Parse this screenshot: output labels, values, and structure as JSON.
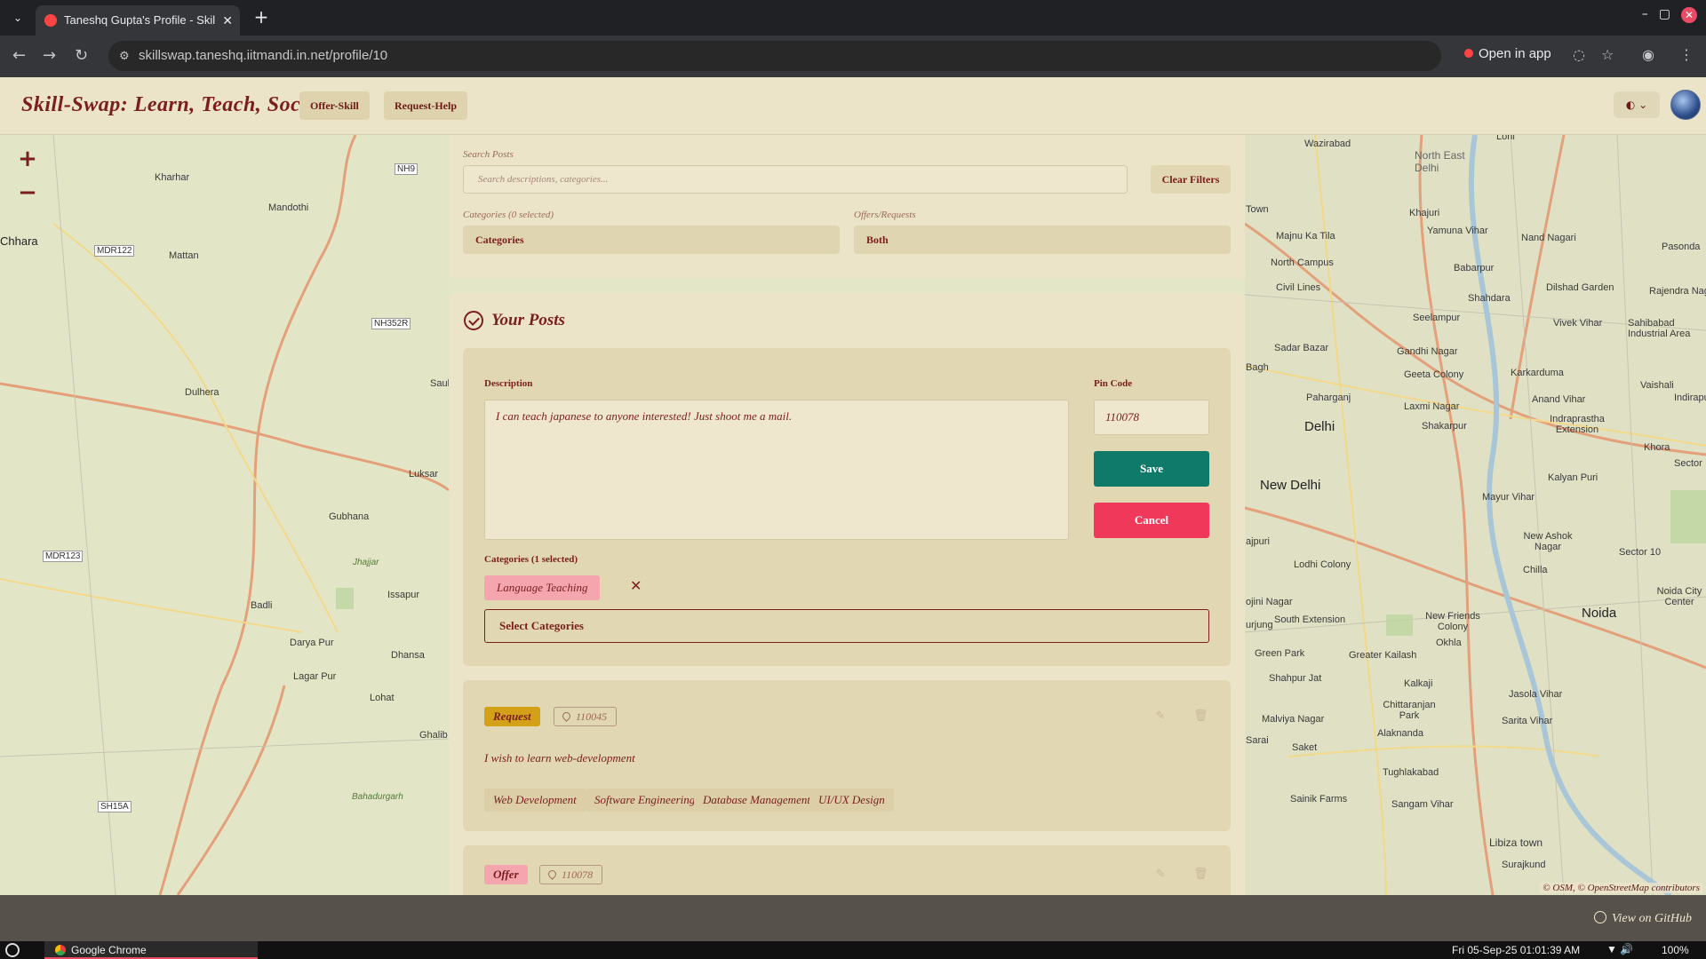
{
  "browser": {
    "tab_title": "Taneshq Gupta's Profile - Skil",
    "url": "skillswap.taneshq.iitmandi.in.net/profile/10",
    "open_in_app": "Open in app"
  },
  "header": {
    "brand": "Skill-Swap: Learn, Teach, Socialise",
    "offer_skill": "Offer-Skill",
    "request_help": "Request-Help"
  },
  "filters": {
    "search_label": "Search Posts",
    "search_placeholder": "Search descriptions, categories...",
    "clear_filters": "Clear Filters",
    "categories_label": "Categories (0 selected)",
    "categories_value": "Categories",
    "offers_label": "Offers/Requests",
    "offers_value": "Both"
  },
  "posts": {
    "title": "Your Posts",
    "edit": {
      "description_label": "Description",
      "description": "I can teach japanese to anyone interested! Just shoot me a mail.",
      "pincode_label": "Pin Code",
      "pincode": "110078",
      "save": "Save",
      "cancel": "Cancel",
      "categories_label": "Categories (1 selected)",
      "selected_category": "Language Teaching",
      "select_categories": "Select Categories"
    },
    "items": [
      {
        "type": "Request",
        "pincode": "110045",
        "description": "I wish to learn web-development",
        "tags": [
          "Web Development",
          "Software Engineering",
          "Database Management",
          "UI/UX Design"
        ]
      },
      {
        "type": "Offer",
        "pincode": "110078"
      }
    ]
  },
  "map": {
    "attribution": "© OSM, © OpenStreetMap contributors",
    "labels_west": [
      "Kharhar",
      "Mandothi",
      "Chhara",
      "Mattan",
      "Dulhera",
      "Luksar",
      "Gubhana",
      "Jhajjar",
      "Issapur",
      "Badli",
      "Darya Pur",
      "Dhansa",
      "Lagar Pur",
      "Lohat",
      "Ghalib",
      "Saul",
      "Bahadurgarh"
    ],
    "roads_west": [
      "NH9",
      "MDR122",
      "NH352R",
      "MDR123",
      "SH15A"
    ],
    "labels_east": [
      "Wazirabad",
      "Loni",
      "North East Delhi",
      "Khajuri",
      "Yamuna Vihar",
      "Nand Nagari",
      "Pasonda",
      "Majnu Ka Tila",
      "North Campus",
      "Babarpur",
      "Dilshad Garden",
      "Rajendra Nag",
      "Civil Lines",
      "Shahdara",
      "Seelampur",
      "Vivek Vihar",
      "Sahibabad Industrial Area",
      "Sadar Bazar",
      "Gandhi Nagar",
      "Geeta Colony",
      "Karkarduma",
      "Vaishali",
      "Paharganj",
      "Laxmi Nagar",
      "Anand Vihar",
      "Indirapu",
      "Delhi",
      "Shakarpur",
      "Indraprastha Extension",
      "Khora",
      "New Delhi",
      "Kalyan Puri",
      "Sector",
      "Mayur Vihar",
      "Lodhi Colony",
      "New Ashok Nagar",
      "Chilla",
      "Sector 10",
      "South Extension",
      "New Friends Colony",
      "Noida City Center",
      "Noida",
      "Green Park",
      "Greater Kailash",
      "Okhla",
      "Shahpur Jat",
      "Kalkaji",
      "Jasola Vihar",
      "Malviya Nagar",
      "Chittaranjan Park",
      "Sarita Vihar",
      "Saket",
      "Alaknanda",
      "Tughlakabad",
      "Sainik Farms",
      "Sangam Vihar",
      "Libiza town",
      "Surajkund",
      "Town",
      "Bagh",
      "ajpuri",
      "ojini Nagar",
      "urjung",
      "Sarai"
    ]
  },
  "footer": {
    "github": "View on GitHub"
  },
  "taskbar": {
    "app": "Google Chrome",
    "clock": "Fri 05-Sep-25 01:01:39 AM",
    "battery": "100%"
  },
  "colors": {
    "primary": "#7a1e1e",
    "save": "#0f7a6a",
    "cancel": "#f0395a",
    "request_badge": "#d4a017",
    "offer_badge": "#f4a5ad"
  }
}
